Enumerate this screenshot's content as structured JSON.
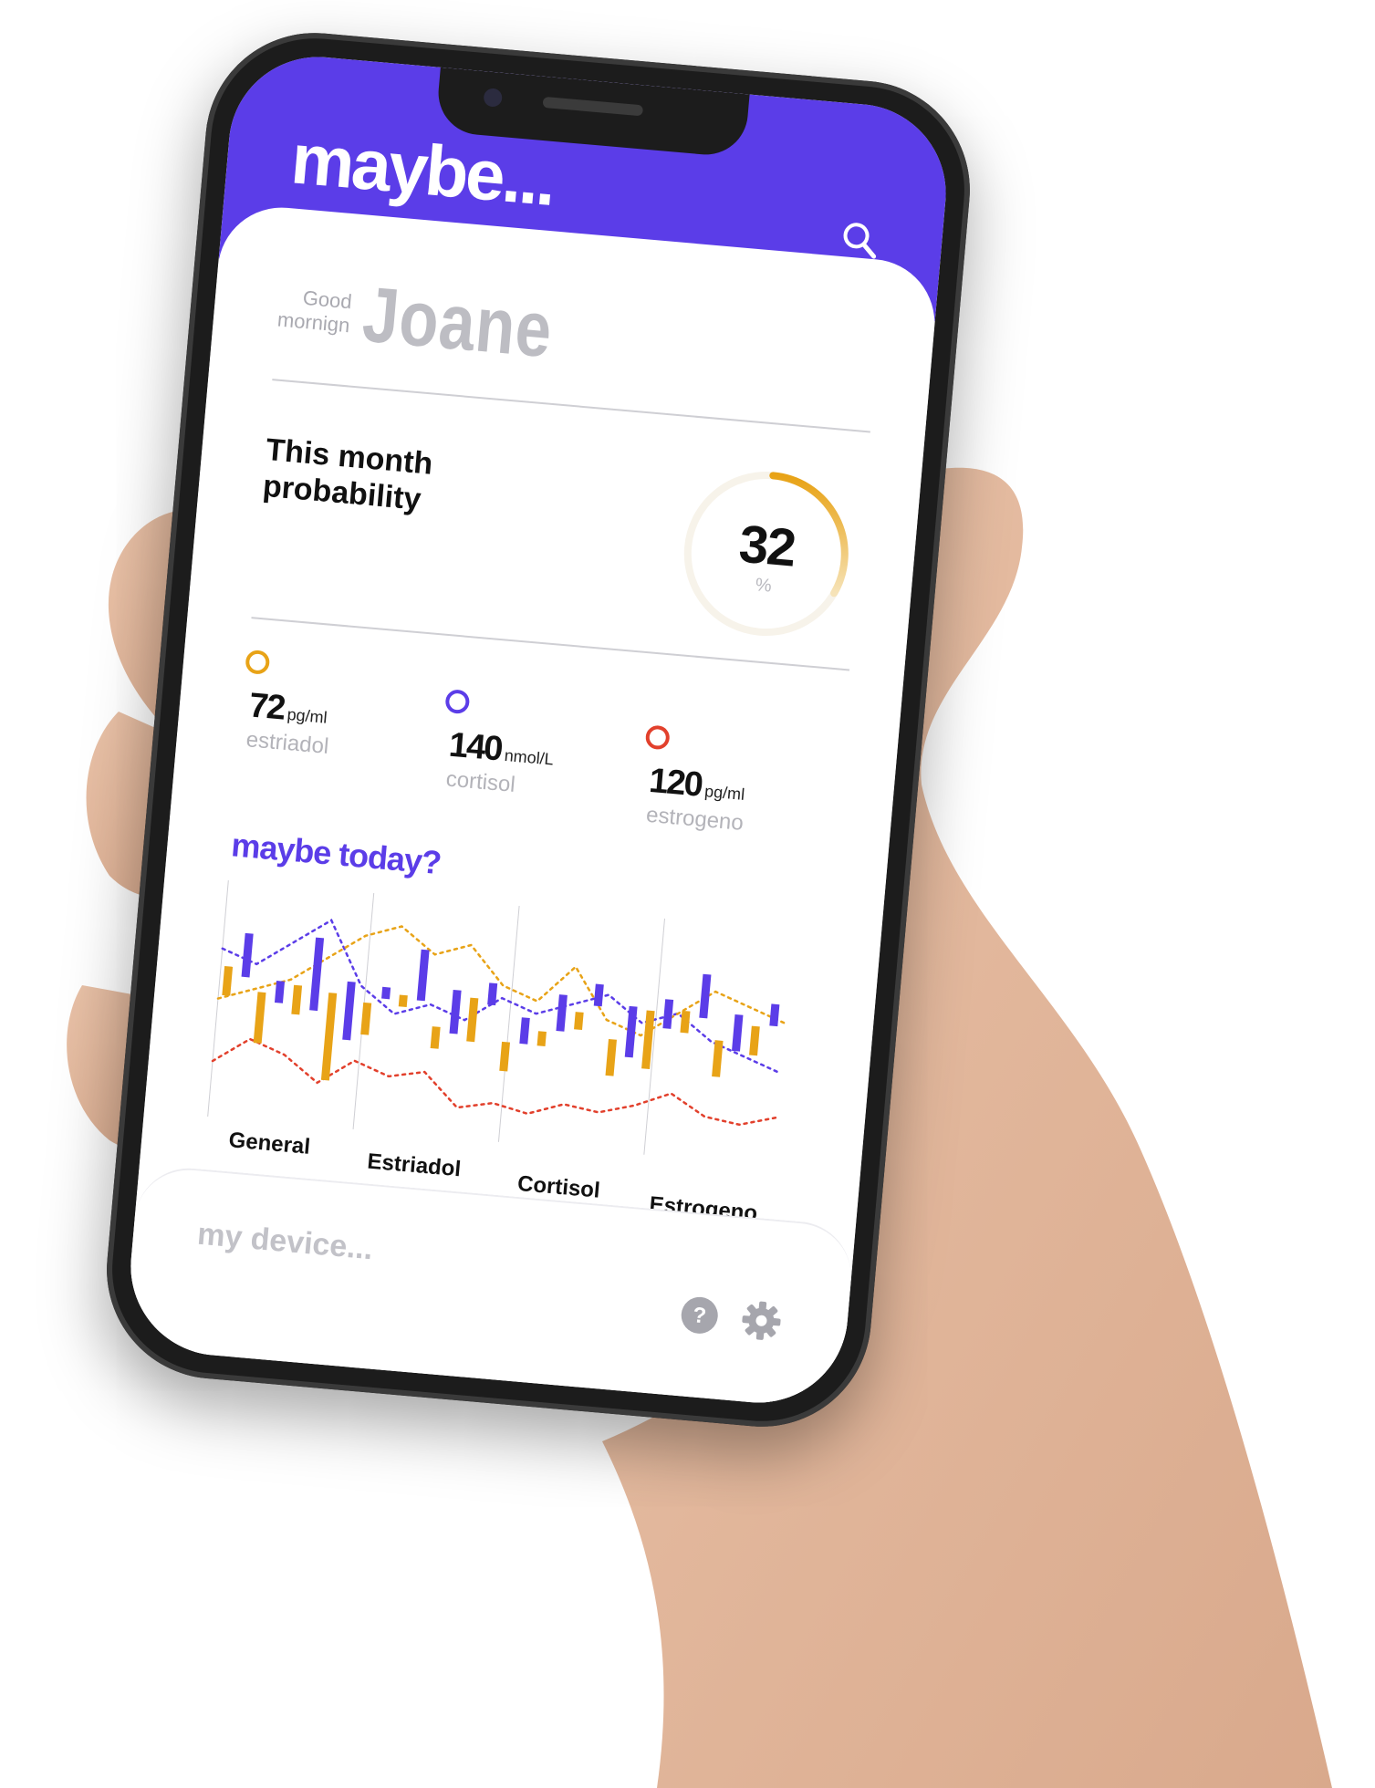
{
  "app": {
    "brand": "maybe..."
  },
  "greeting": {
    "line1": "Good",
    "line2": "mornign",
    "name": "Joane"
  },
  "probability": {
    "title": "This month probability",
    "value": "32",
    "unit": "%",
    "fraction": 0.32
  },
  "metrics": [
    {
      "value": "72",
      "unit": "pg/ml",
      "name": "estriadol",
      "color": "#e8a317"
    },
    {
      "value": "140",
      "unit": "nmol/L",
      "name": "cortisol",
      "color": "#5b3de8"
    },
    {
      "value": "120",
      "unit": "pg/ml",
      "name": "estrogeno",
      "color": "#e2402c"
    }
  ],
  "chart_title": "maybe today?",
  "chart_data": {
    "type": "bar",
    "categories": [
      "General",
      "Estriadol",
      "Cortisol",
      "Estrogeno"
    ],
    "series": [
      {
        "values": [
          2,
          3.5,
          2,
          6,
          2.2,
          0.8,
          1.5,
          3,
          2,
          1,
          1.2,
          2.5,
          4,
          1.5,
          2.5,
          2
        ]
      },
      {
        "values": [
          3,
          1.5,
          5,
          4,
          0.8,
          3.5,
          3,
          1.5,
          1.8,
          2.5,
          1.5,
          3.5,
          2,
          3,
          2.5,
          1.5
        ]
      }
    ],
    "lines": [
      {
        "color": "#5b3de8",
        "values": [
          6,
          5.5,
          6.5,
          7.5,
          5,
          4,
          4.5,
          4,
          5,
          4.5,
          5,
          5.5,
          4.5,
          5,
          4,
          3.5,
          3
        ]
      },
      {
        "color": "#e8a317",
        "values": [
          4,
          4.5,
          5,
          6,
          7,
          7.5,
          6.5,
          7,
          5.5,
          5,
          6.5,
          4.5,
          4,
          5,
          6,
          5.5,
          5
        ]
      },
      {
        "color": "#e2402c",
        "values": [
          1.5,
          2.5,
          2,
          1,
          2,
          1.5,
          1.8,
          0.5,
          0.8,
          0.5,
          1,
          0.8,
          1.2,
          1.8,
          1,
          0.8,
          1.2
        ]
      }
    ],
    "colors": [
      "#e8a317",
      "#5b3de8"
    ]
  },
  "footer": {
    "label": "my device..."
  },
  "icons": {
    "search": "search-icon",
    "help": "help-icon",
    "settings": "gear-icon"
  },
  "colors": {
    "accent": "#5b3de8",
    "gold": "#e8a317",
    "red": "#e2402c"
  }
}
